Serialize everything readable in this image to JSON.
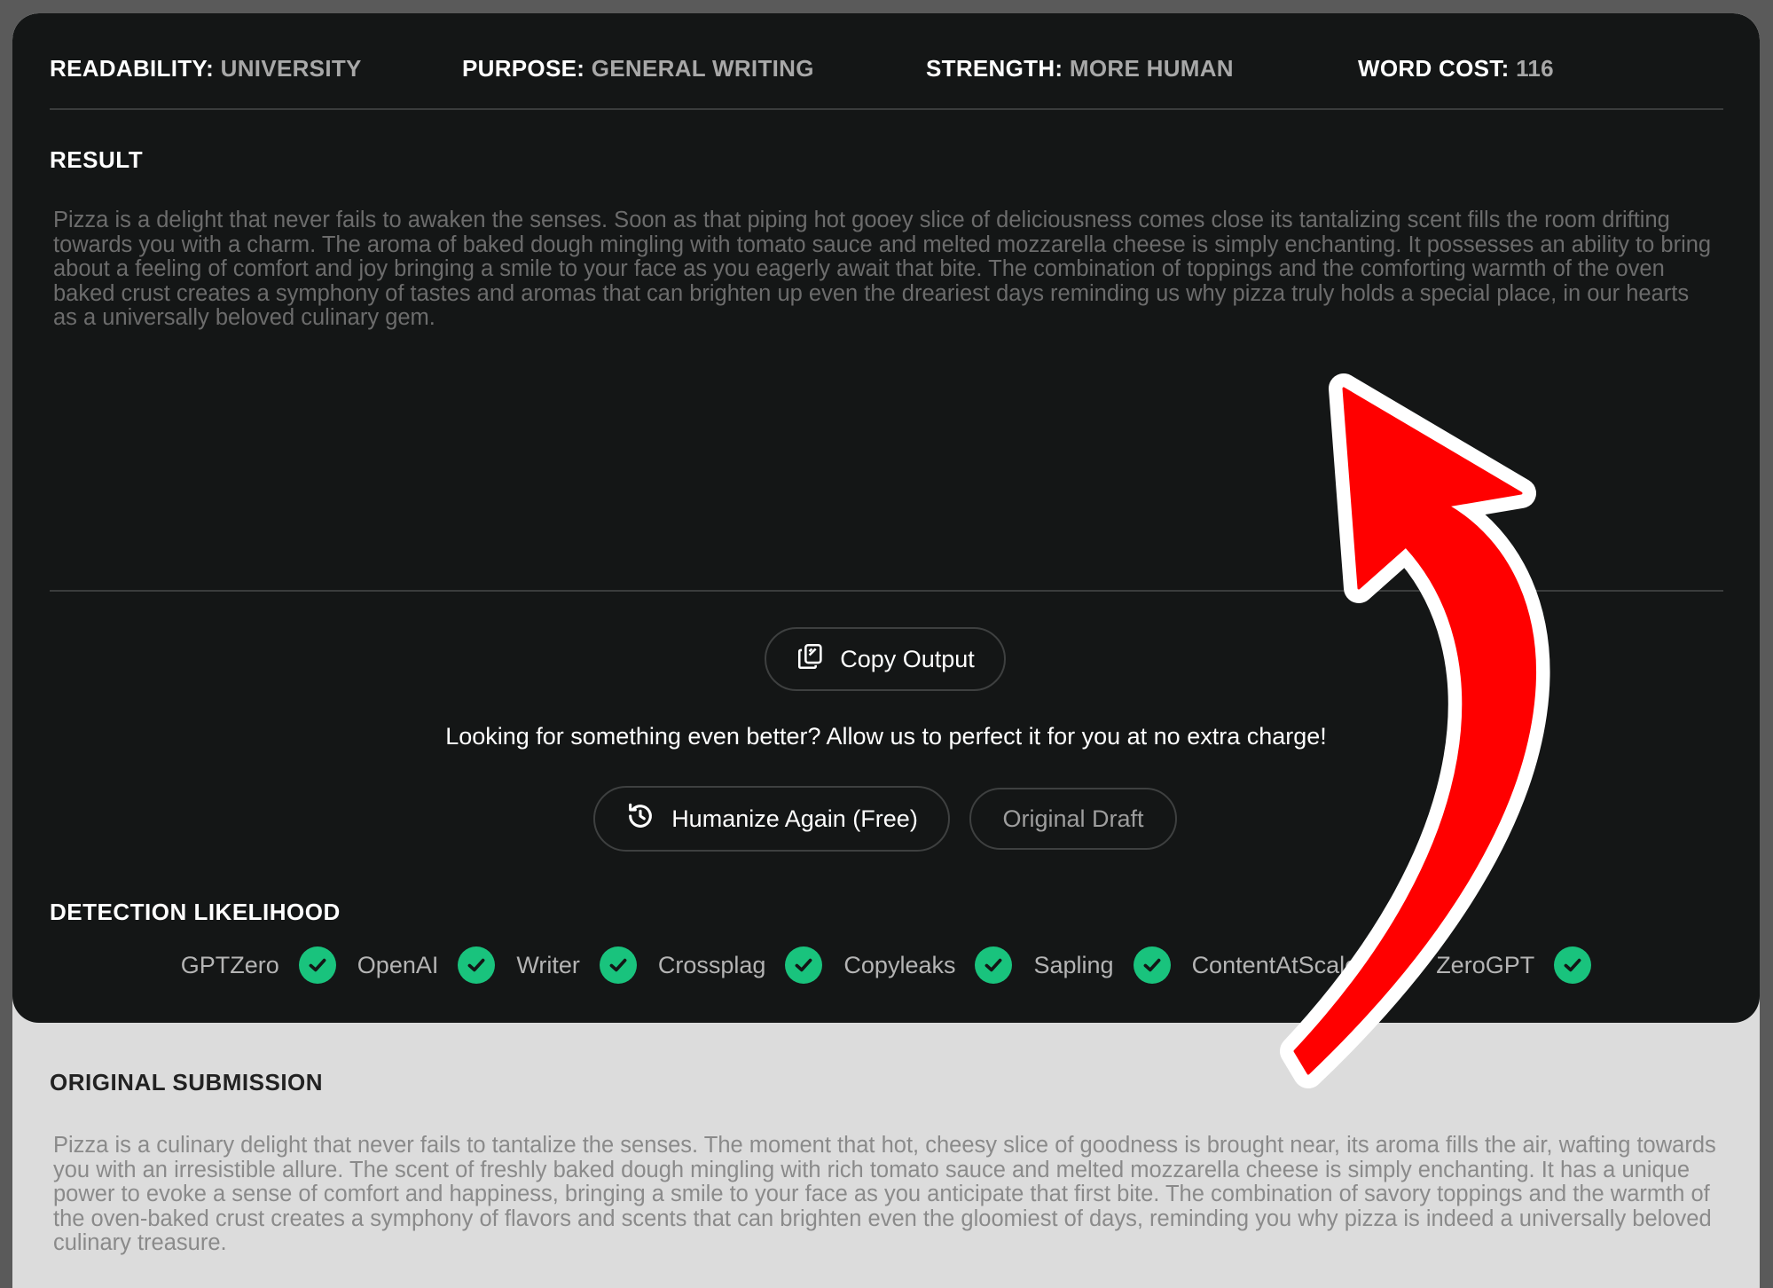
{
  "settings": {
    "readability_label": "READABILITY:",
    "readability_value": "UNIVERSITY",
    "purpose_label": "PURPOSE:",
    "purpose_value": "GENERAL WRITING",
    "strength_label": "STRENGTH:",
    "strength_value": "MORE HUMAN",
    "word_cost_label": "WORD COST:",
    "word_cost_value": "116"
  },
  "result": {
    "title": "RESULT",
    "text": "Pizza is a delight that never fails to awaken the senses. Soon as that piping hot gooey slice of deliciousness comes close its tantalizing scent fills the room drifting towards you with a charm. The aroma of baked dough mingling with tomato sauce and melted mozzarella cheese is simply enchanting. It possesses an ability to bring about a feeling of comfort and joy bringing a smile to your face as you eagerly await that bite. The combination of toppings and the comforting warmth of the oven baked crust creates a symphony of tastes and aromas that can brighten up even the dreariest days reminding us why pizza truly holds a special place, in our hearts as a universally beloved culinary gem."
  },
  "actions": {
    "copy_label": "Copy Output",
    "promo_text": "Looking for something even better? Allow us to perfect it for you at no extra charge!",
    "humanize_again_label": "Humanize Again (Free)",
    "original_draft_label": "Original Draft"
  },
  "detection": {
    "title": "DETECTION LIKELIHOOD",
    "detectors": [
      {
        "name": "GPTZero",
        "status": "passed"
      },
      {
        "name": "OpenAI",
        "status": "passed"
      },
      {
        "name": "Writer",
        "status": "passed"
      },
      {
        "name": "Crossplag",
        "status": "passed"
      },
      {
        "name": "Copyleaks",
        "status": "passed"
      },
      {
        "name": "Sapling",
        "status": "passed"
      },
      {
        "name": "ContentAtScale",
        "status": "passed"
      },
      {
        "name": "ZeroGPT",
        "status": "passed"
      }
    ]
  },
  "original": {
    "title": "ORIGINAL SUBMISSION",
    "text": "Pizza is a culinary delight that never fails to tantalize the senses. The moment that hot, cheesy slice of goodness is brought near, its aroma fills the air, wafting towards you with an irresistible allure. The scent of freshly baked dough mingling with rich tomato sauce and melted mozzarella cheese is simply enchanting. It has a unique power to evoke a sense of comfort and happiness, bringing a smile to your face as you anticipate that first bite. The combination of savory toppings and the warmth of the oven-baked crust creates a symphony of flavors and scents that can brighten even the gloomiest of days, reminding you why pizza is indeed a universally beloved culinary treasure."
  },
  "colors": {
    "panel_bg": "#141616",
    "page_bg": "#dcdcdc",
    "check_green": "#19c37d",
    "arrow_red": "#ff0000"
  },
  "icons": {
    "copy": "copy-icon",
    "humanize_again": "history-icon",
    "check": "check-circle-icon",
    "annotation": "red-arrow-annotation"
  }
}
